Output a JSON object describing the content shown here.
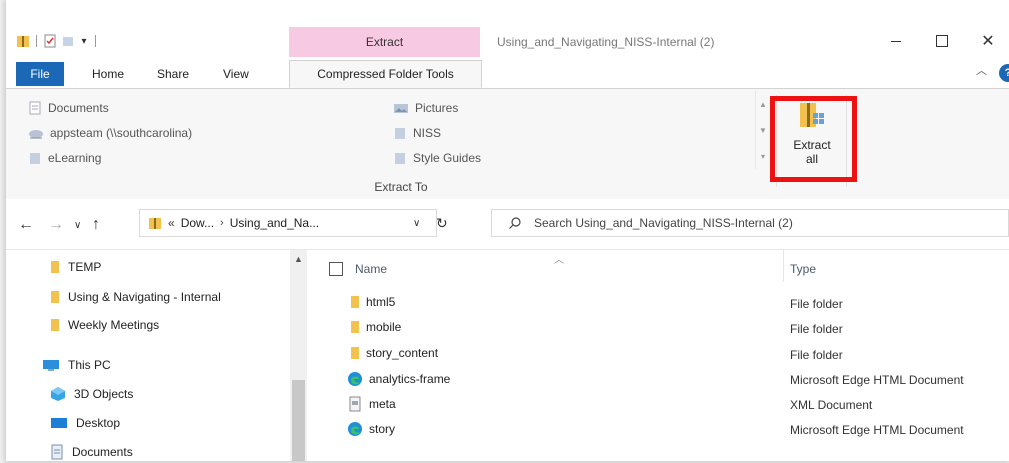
{
  "title_bar": {
    "context_tab": "Extract",
    "window_title": "Using_and_Navigating_NISS-Internal (2)",
    "controls": [
      "minimize",
      "maximize",
      "close"
    ]
  },
  "ribbon_tabs": {
    "file": "File",
    "home": "Home",
    "share": "Share",
    "view": "View",
    "compressed": "Compressed Folder Tools",
    "help": "?"
  },
  "ribbon": {
    "extract_to_items": [
      {
        "label": "Documents",
        "icon": "documents-icon"
      },
      {
        "label": "appsteam (\\\\southcarolina)",
        "icon": "network-drive-icon"
      },
      {
        "label": "eLearning",
        "icon": "folder-icon"
      },
      {
        "label": "Pictures",
        "icon": "pictures-icon"
      },
      {
        "label": "NISS",
        "icon": "folder-icon"
      },
      {
        "label": "Style Guides",
        "icon": "folder-icon"
      }
    ],
    "group_label": "Extract To",
    "extract_all": "Extract\nall"
  },
  "address": {
    "prefix": "«",
    "segments": [
      "Dow...",
      "Using_and_Na..."
    ]
  },
  "search": {
    "placeholder": "Search Using_and_Navigating_NISS-Internal (2)"
  },
  "nav_pane": {
    "items": [
      {
        "label": "TEMP",
        "icon": "folder-icon"
      },
      {
        "label": "Using & Navigating - Internal",
        "icon": "folder-icon"
      },
      {
        "label": "Weekly Meetings",
        "icon": "folder-icon"
      },
      {
        "label": "This PC",
        "icon": "this-pc-icon"
      },
      {
        "label": "3D Objects",
        "icon": "3d-objects-icon"
      },
      {
        "label": "Desktop",
        "icon": "desktop-icon"
      },
      {
        "label": "Documents",
        "icon": "documents-icon"
      }
    ]
  },
  "file_list": {
    "columns": {
      "name": "Name",
      "type": "Type"
    },
    "rows": [
      {
        "name": "html5",
        "type": "File folder",
        "icon": "folder-icon"
      },
      {
        "name": "mobile",
        "type": "File folder",
        "icon": "folder-icon"
      },
      {
        "name": "story_content",
        "type": "File folder",
        "icon": "folder-icon"
      },
      {
        "name": "analytics-frame",
        "type": "Microsoft Edge HTML Document",
        "icon": "edge-icon"
      },
      {
        "name": "meta",
        "type": "XML Document",
        "icon": "xml-file-icon"
      },
      {
        "name": "story",
        "type": "Microsoft Edge HTML Document",
        "icon": "edge-icon"
      }
    ]
  },
  "colors": {
    "file_tab": "#1b69b6",
    "context_tab": "#f8c9e3",
    "highlight": "#ee1111",
    "folder": "#f2c14e"
  }
}
